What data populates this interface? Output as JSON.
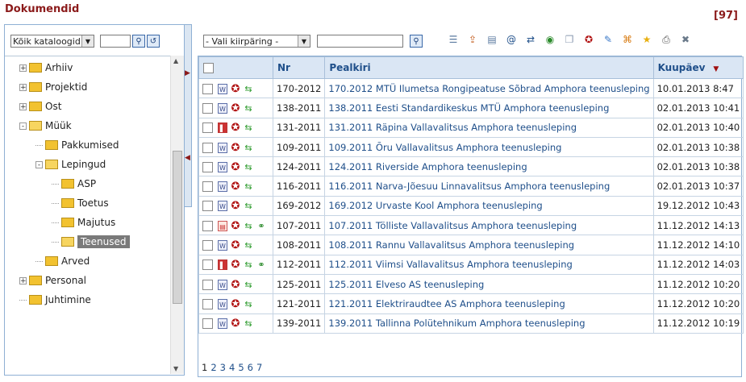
{
  "header": {
    "title": "Dokumendid",
    "count": "[97]"
  },
  "left": {
    "catalog_select": "Kõik kataloogid",
    "search_value": "",
    "tree": [
      {
        "label": "Arhiiv",
        "level": 0,
        "expander": "+",
        "open": false
      },
      {
        "label": "Projektid",
        "level": 0,
        "expander": "+",
        "open": false
      },
      {
        "label": "Ost",
        "level": 0,
        "expander": "+",
        "open": false
      },
      {
        "label": "Müük",
        "level": 0,
        "expander": "-",
        "open": true
      },
      {
        "label": "Pakkumised",
        "level": 1,
        "expander": "",
        "open": false
      },
      {
        "label": "Lepingud",
        "level": 1,
        "expander": "-",
        "open": true
      },
      {
        "label": "ASP",
        "level": 2,
        "expander": "",
        "open": false
      },
      {
        "label": "Toetus",
        "level": 2,
        "expander": "",
        "open": false
      },
      {
        "label": "Majutus",
        "level": 2,
        "expander": "",
        "open": false
      },
      {
        "label": "Teenused",
        "level": 2,
        "expander": "",
        "open": true,
        "selected": true
      },
      {
        "label": "Arved",
        "level": 1,
        "expander": "",
        "open": false
      },
      {
        "label": "Personal",
        "level": 0,
        "expander": "+",
        "open": false
      },
      {
        "label": "Juhtimine",
        "level": 0,
        "expander": "",
        "open": false
      }
    ]
  },
  "right": {
    "quick_select": "- Vali kiirpäring -",
    "search_value": "",
    "toolbar_icons": [
      "list-icon",
      "export-icon",
      "archive-icon",
      "email-icon",
      "transfer-icon",
      "web-icon",
      "copy-icon",
      "award-icon",
      "sign-icon",
      "xml-icon",
      "star-icon",
      "print-icon",
      "delete-icon"
    ],
    "columns": {
      "nr": "Nr",
      "pealkiri": "Pealkiri",
      "kuupaev": "Kuupäev"
    },
    "rows": [
      {
        "doc": "word",
        "extra": false,
        "nr": "170-2012",
        "title": "170.2012 MTÜ Ilumetsa Rongipeatuse Sõbrad Amphora teenusleping",
        "date": "10.01.2013 8:47"
      },
      {
        "doc": "word",
        "extra": false,
        "nr": "138-2011",
        "title": "138.2011 Eesti Standardikeskus MTÜ Amphora teenusleping",
        "date": "02.01.2013 10:41"
      },
      {
        "doc": "pdf",
        "extra": false,
        "nr": "131-2011",
        "title": "131.2011 Räpina Vallavalitsus Amphora teenusleping",
        "date": "02.01.2013 10:40"
      },
      {
        "doc": "word",
        "extra": false,
        "nr": "109-2011",
        "title": "109.2011 Õru Vallavalitsus Amphora teenusleping",
        "date": "02.01.2013 10:38"
      },
      {
        "doc": "word",
        "extra": false,
        "nr": "124-2011",
        "title": "124.2011 Riverside Amphora teenusleping",
        "date": "02.01.2013 10:38"
      },
      {
        "doc": "word",
        "extra": false,
        "nr": "116-2011",
        "title": "116.2011 Narva-Jõesuu Linnavalitsus Amphora teenusleping",
        "date": "02.01.2013 10:37"
      },
      {
        "doc": "word",
        "extra": false,
        "nr": "169-2012",
        "title": "169.2012 Urvaste Kool Amphora teenusleping",
        "date": "19.12.2012 10:43"
      },
      {
        "doc": "pdf2",
        "extra": true,
        "nr": "107-2011",
        "title": "107.2011 Tölliste Vallavalitsus Amphora teenusleping",
        "date": "11.12.2012 14:13"
      },
      {
        "doc": "word",
        "extra": false,
        "nr": "108-2011",
        "title": "108.2011 Rannu Vallavalitsus Amphora teenusleping",
        "date": "11.12.2012 14:10"
      },
      {
        "doc": "pdf",
        "extra": true,
        "nr": "112-2011",
        "title": "112.2011 Viimsi Vallavalitsus Amphora teenusleping",
        "date": "11.12.2012 14:03"
      },
      {
        "doc": "word",
        "extra": false,
        "nr": "125-2011",
        "title": "125.2011 Elveso AS teenusleping",
        "date": "11.12.2012 10:20"
      },
      {
        "doc": "word",
        "extra": false,
        "nr": "121-2011",
        "title": "121.2011 Elektriraudtee AS Amphora teenusleping",
        "date": "11.12.2012 10:20"
      },
      {
        "doc": "word",
        "extra": false,
        "nr": "139-2011",
        "title": "139.2011 Tallinna Polütehnikum Amphora teenusleping",
        "date": "11.12.2012 10:19"
      }
    ],
    "pages": [
      "1",
      "2",
      "3",
      "4",
      "5",
      "6",
      "7"
    ]
  }
}
